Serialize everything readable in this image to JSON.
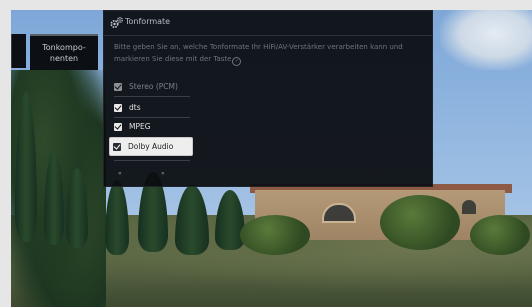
{
  "nav": {
    "tab_label": "Tonkompo-\nnenten"
  },
  "dialog": {
    "title": "Tonformate",
    "instruction": "Bitte geben Sie an, welche Tonformate Ihr HiFi/AV-Verstärker verarbeiten kann und markieren Sie diese mit der Taste",
    "options": [
      {
        "label": "Stereo (PCM)",
        "checked": true,
        "state": "disabled"
      },
      {
        "label": "dts",
        "checked": true,
        "state": "normal"
      },
      {
        "label": "MPEG",
        "checked": true,
        "state": "normal"
      },
      {
        "label": "Dolby Audio",
        "checked": true,
        "state": "selected"
      }
    ],
    "prev_page_label": "«",
    "next_page_label": "»"
  },
  "colors": {
    "dialog_background": "#0a0c0f",
    "selected_background": "#eeeeee",
    "text": "#e0e2e5",
    "muted_text": "#6f757c"
  }
}
